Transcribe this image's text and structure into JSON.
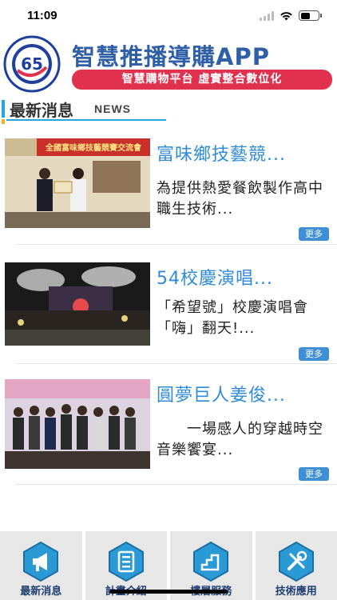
{
  "status_bar": {
    "time": "11:09",
    "battery_level": 0.55
  },
  "header": {
    "app_title": "智慧推播導購APP",
    "subtitle": "智慧購物平台 虛實整合數位化",
    "logo_icon": "cheng-shiu-university-logo",
    "logo_text_top": "CHENG SHIU UNIVERSITY",
    "logo_text_bottom": "正修科技大學",
    "logo_number": "65"
  },
  "section": {
    "title": "最新消息",
    "title_en": "NEWS"
  },
  "news": [
    {
      "title": "富味鄉技藝競...",
      "summary": "為提供熱愛餐飲製作高中職生技術...",
      "more_label": "更多",
      "image_banner_text": "全國富味鄉技藝競賽交流會"
    },
    {
      "title": "54校慶演唱...",
      "summary": "「希望號」校慶演唱會「嗨」翻天!...",
      "more_label": "更多"
    },
    {
      "title": "圓夢巨人姜俊...",
      "summary": "　　一場感人的穿越時空音樂饗宴...",
      "more_label": "更多"
    }
  ],
  "tabs": [
    {
      "label": "最新消息",
      "icon": "megaphone-icon"
    },
    {
      "label": "計畫介紹",
      "icon": "document-list-icon"
    },
    {
      "label": "樓層服務",
      "icon": "stairs-icon"
    },
    {
      "label": "技術應用",
      "icon": "tools-icon"
    }
  ],
  "colors": {
    "brand_blue": "#2f5fa7",
    "accent_red": "#e0324f",
    "link_blue": "#2f8bd8",
    "button_blue": "#3f8fd4",
    "tab_bg": "#e7e7e7",
    "hex_icon": "#2a9ad6"
  }
}
